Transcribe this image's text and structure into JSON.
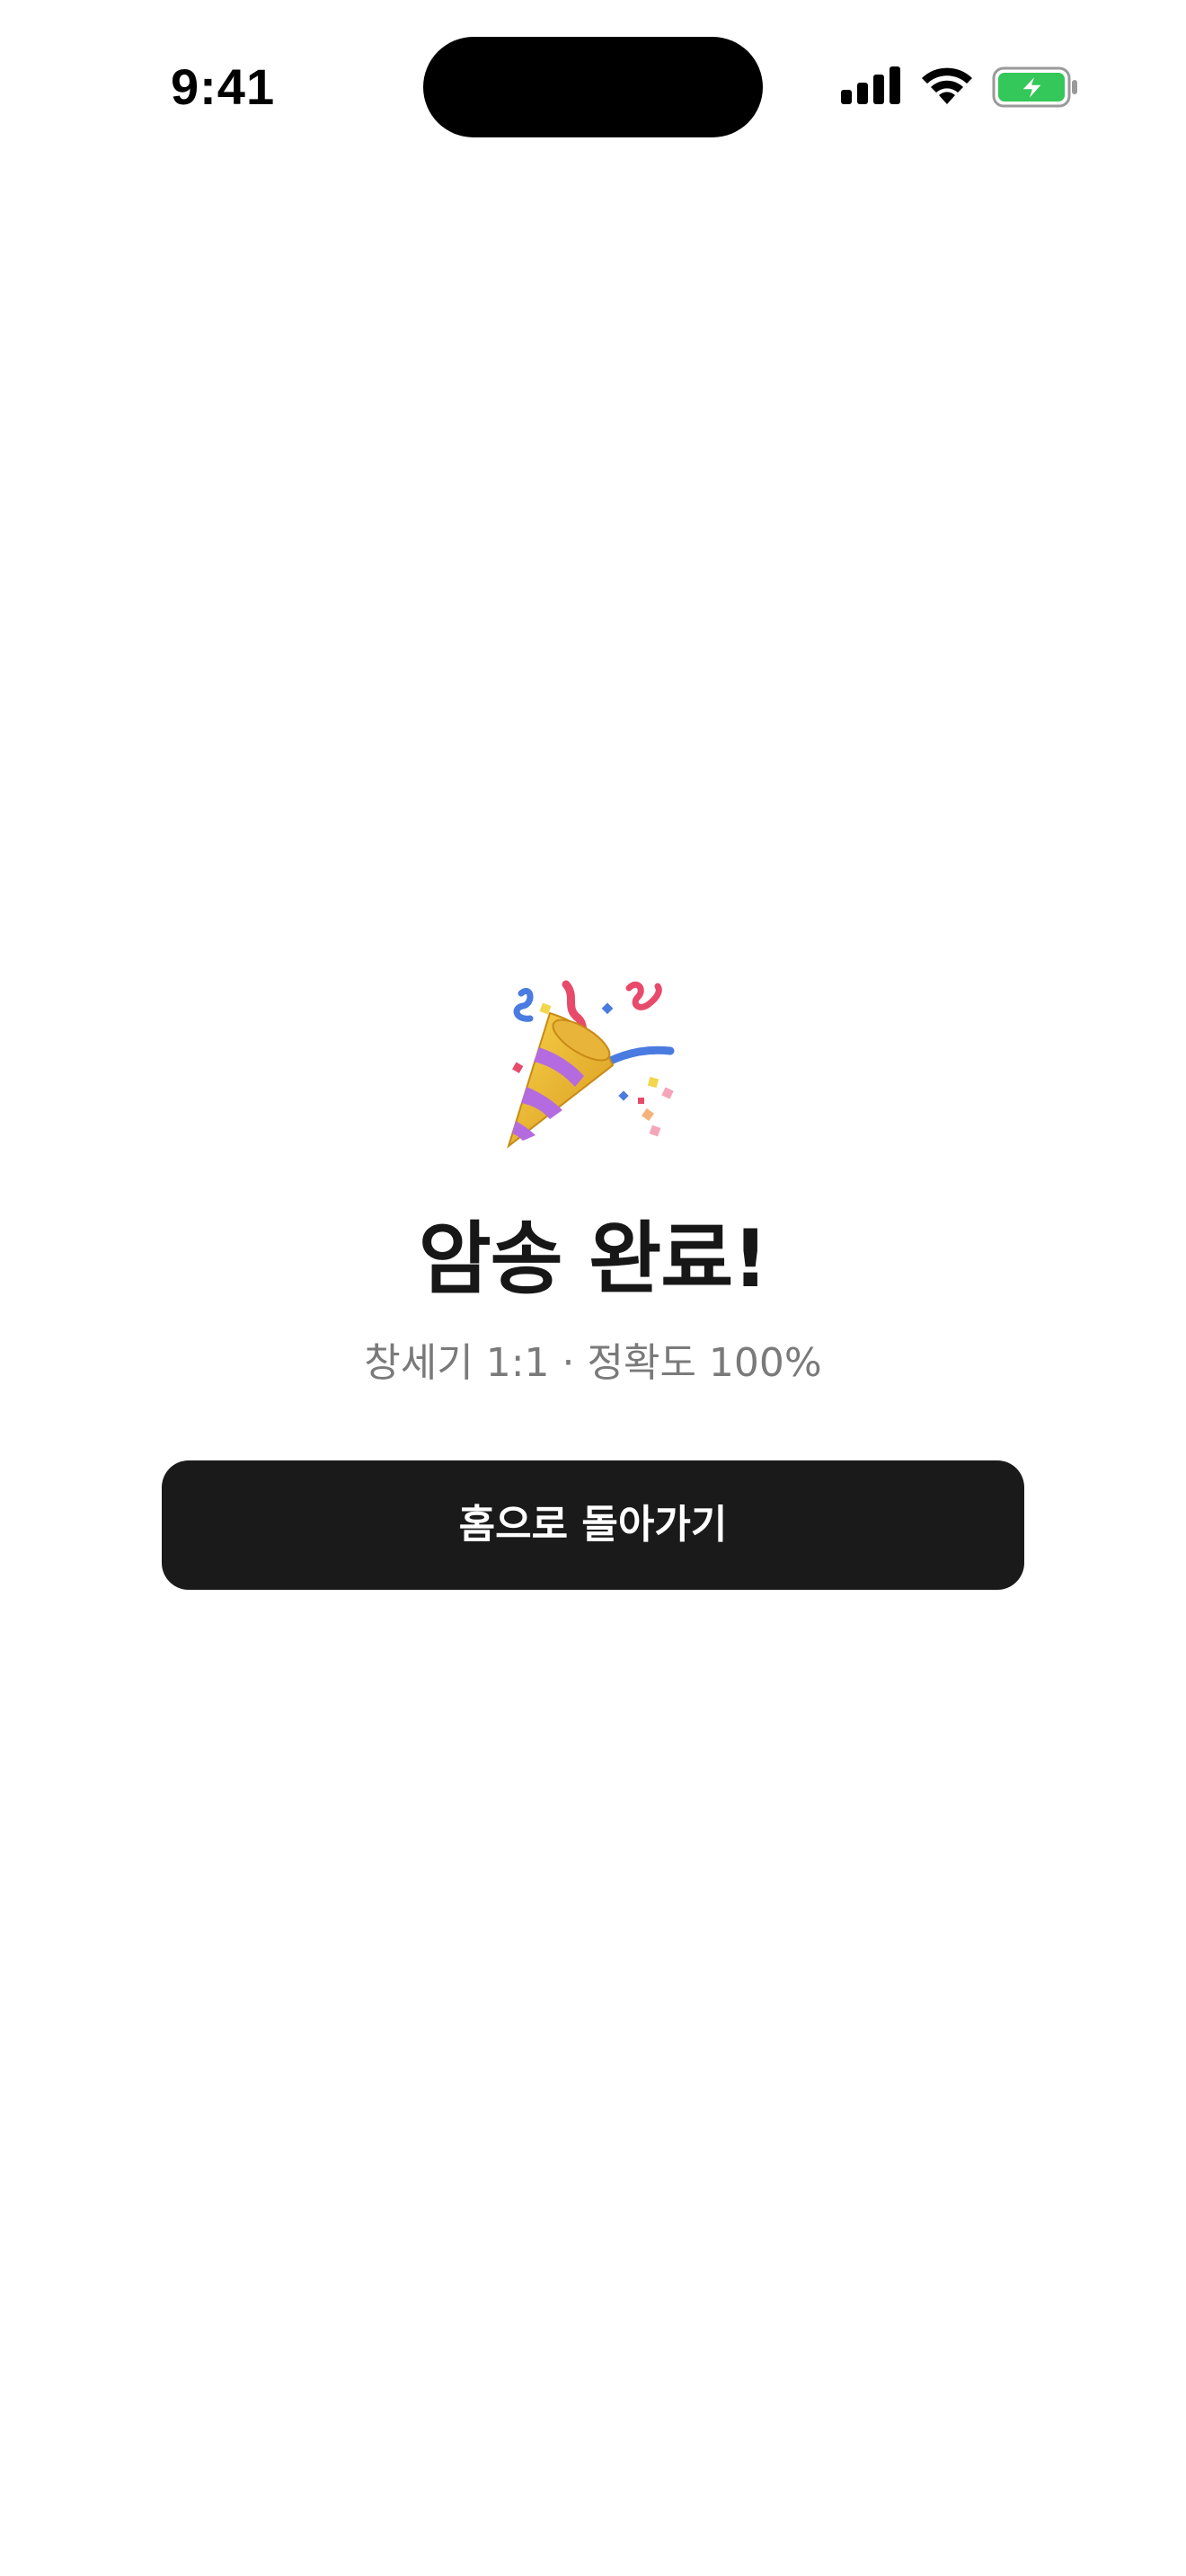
{
  "status_bar": {
    "time": "9:41",
    "icons": [
      "cellular-signal-icon",
      "wifi-icon",
      "battery-charging-icon"
    ],
    "battery_color": "#34C759"
  },
  "main": {
    "icon": "party-popper-icon",
    "title": "암송 완료!",
    "summary": "창세기 1:1 · 정확도 100%",
    "home_button_label": "홈으로 돌아가기"
  },
  "colors": {
    "background": "#FFFFFF",
    "title_text": "#171717",
    "summary_text": "#7A7A7A",
    "button_background": "#1A1A1A",
    "button_text": "#FFFFFF"
  }
}
